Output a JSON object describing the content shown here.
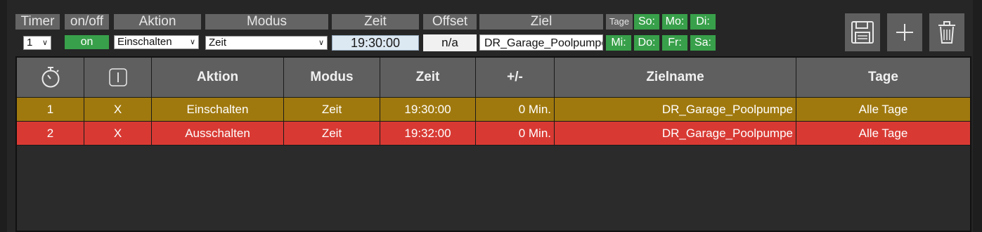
{
  "controls": {
    "headers": {
      "timer": "Timer",
      "onoff": "on/off",
      "aktion": "Aktion",
      "modus": "Modus",
      "zeit": "Zeit",
      "offset": "Offset",
      "ziel": "Ziel"
    },
    "timer_select": "1",
    "onoff_button": "on",
    "aktion_select": "Einschalten",
    "modus_select": "Zeit",
    "zeit_input": "19:30:00",
    "offset_input": "n/a",
    "ziel_input": "DR_Garage_Poolpumpe",
    "tage_label": "Tage",
    "days": [
      "So:",
      "Mo:",
      "Di:",
      "Mi:",
      "Do:",
      "Fr:",
      "Sa:"
    ]
  },
  "toolbar": {
    "save_icon": "floppy-disk-icon",
    "add_icon": "plus-icon",
    "delete_icon": "trash-icon"
  },
  "table": {
    "columns": {
      "timer_icon": "stopwatch-icon",
      "onoff_icon": "power-icon",
      "aktion": "Aktion",
      "modus": "Modus",
      "zeit": "Zeit",
      "offset": "+/-",
      "zielname": "Zielname",
      "tage": "Tage"
    },
    "rows": [
      {
        "nr": "1",
        "onoff": "X",
        "aktion": "Einschalten",
        "modus": "Zeit",
        "zeit": "19:30:00",
        "offset": "0 Min.",
        "zielname": "DR_Garage_Poolpumpe",
        "tage": "Alle Tage"
      },
      {
        "nr": "2",
        "onoff": "X",
        "aktion": "Ausschalten",
        "modus": "Zeit",
        "zeit": "19:32:00",
        "offset": "0 Min.",
        "zielname": "DR_Garage_Poolpumpe",
        "tage": "Alle Tage"
      }
    ]
  },
  "colors": {
    "row_on": "#a0790e",
    "row_off": "#d83a33",
    "day_active": "#38a04a",
    "header_bg": "#5f5f5f"
  }
}
